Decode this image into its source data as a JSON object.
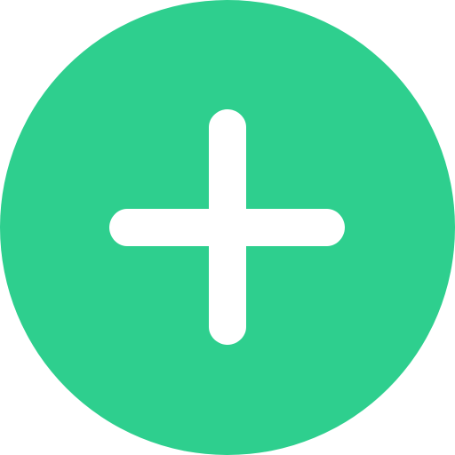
{
  "add_button": {
    "icon": "plus-circle-icon",
    "circle_color": "#2ecf8e",
    "plus_color": "#ffffff"
  }
}
